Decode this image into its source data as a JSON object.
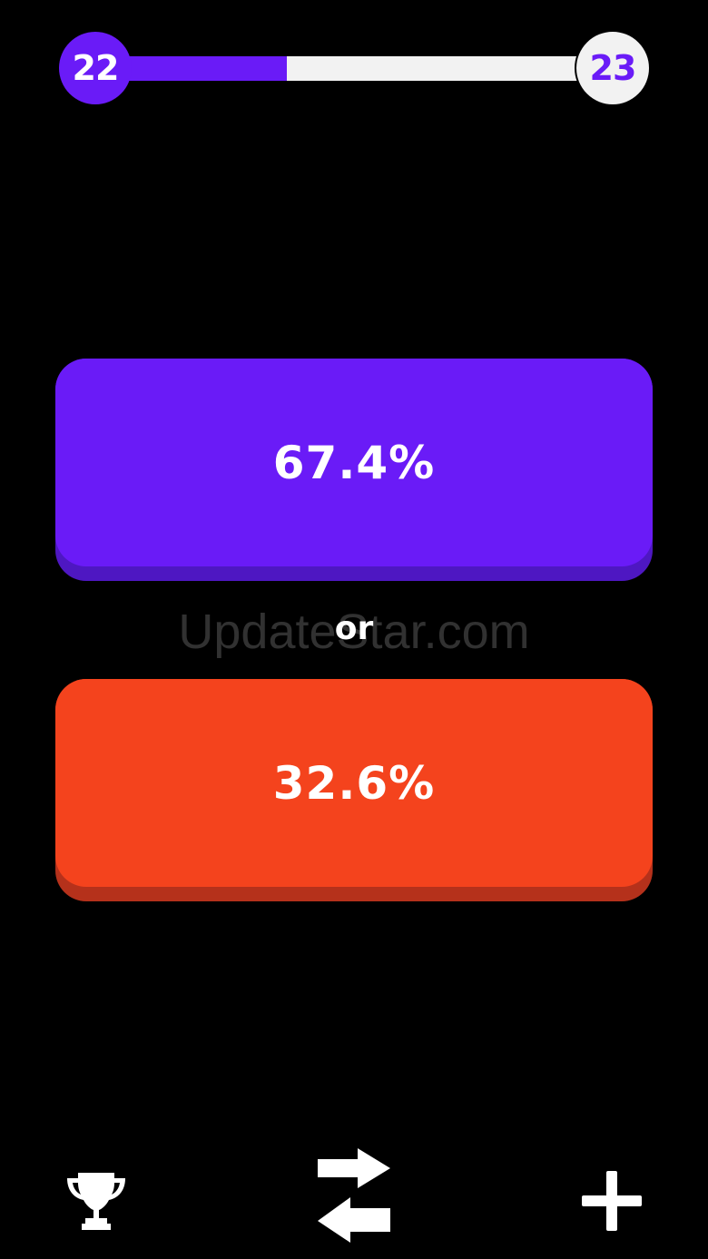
{
  "level": {
    "current": "22",
    "next": "23",
    "progress": 0.37,
    "accent_color": "#6a1bf7",
    "track_color": "#f2f2f2"
  },
  "answers": [
    {
      "percent_label": "67.4%",
      "color": "#6a1bf7"
    },
    {
      "percent_label": "32.6%",
      "color": "#f4431d"
    }
  ],
  "separator": {
    "label": "or"
  },
  "watermark": {
    "text": "UpdateStar.com"
  },
  "bottom_bar": {
    "icons": [
      "trophy-icon",
      "swap-arrows-icon",
      "plus-icon"
    ]
  }
}
